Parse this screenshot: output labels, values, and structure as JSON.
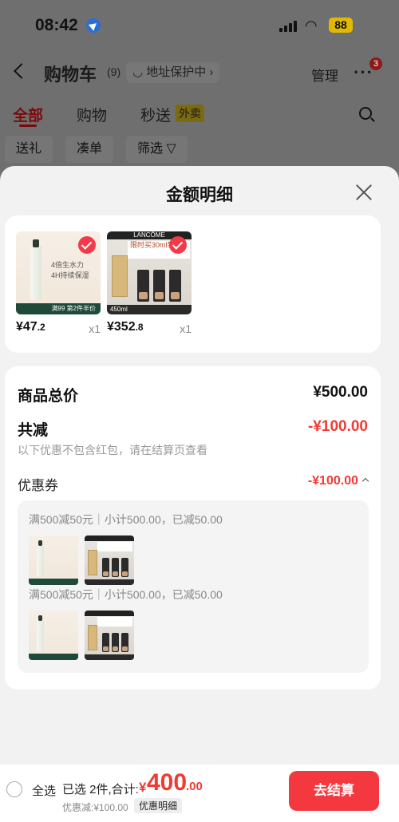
{
  "status_bar": {
    "time": "08:42",
    "battery": "88"
  },
  "navbar": {
    "title": "购物车",
    "count": "(9)",
    "address": "◡ 地址保护中 ›",
    "manage": "管理",
    "more_icon": "more-dots-icon",
    "badge": "3"
  },
  "tabs": {
    "all": "全部",
    "shop": "购物",
    "fast": "秒送",
    "takeout": "外卖"
  },
  "chips": {
    "gift": "送礼",
    "combine": "凑单",
    "filter": "筛选 ▽"
  },
  "sheet": {
    "title": "金额明细",
    "products": [
      {
        "price": "¥47",
        "price_dec": ".2",
        "qty": "x1",
        "img_text": "4倍生水力\n4H持续保湿",
        "band_text": "满99 第2件半价"
      },
      {
        "price": "¥352",
        "price_dec": ".8",
        "qty": "x1",
        "brand": "LANCÔME",
        "img_text": "限时买30ml到手",
        "band_text": "450ml"
      }
    ],
    "summary": {
      "total_label": "商品总价",
      "total_value": "¥500.00",
      "reduce_label": "共减",
      "reduce_value": "-¥100.00",
      "note": "以下优惠不包含红包，请在结算页查看",
      "coupon_label": "优惠券",
      "coupon_value": "-¥100.00"
    },
    "coupon_groups": [
      {
        "title": "满500减50元｜小计500.00，已减50.00"
      },
      {
        "title": "满500减50元｜小计500.00，已减50.00"
      }
    ]
  },
  "bottom_bar": {
    "select_all": "全选",
    "selected": "已选 2件,合计:",
    "currency": "¥",
    "total_int": "400",
    "total_dec": ".00",
    "discount": "优惠减:¥100.00",
    "detail_btn": "优惠明细",
    "checkout": "去结算"
  },
  "colors": {
    "accent": "#f3393f",
    "red_text": "#f03b33",
    "sheet_bg": "#f2f2f2"
  }
}
